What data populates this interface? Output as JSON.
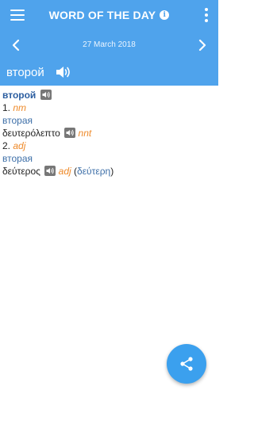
{
  "appbar": {
    "title": "WORD OF THE DAY",
    "menu_icon": "hamburger-menu-icon",
    "info_icon": "info-icon",
    "overflow_icon": "more-vertical-icon"
  },
  "date_nav": {
    "date": "27 March 2018",
    "prev_icon": "chevron-left-icon",
    "next_icon": "chevron-right-icon"
  },
  "word": {
    "headword": "второй",
    "speaker_icon": "speaker-icon"
  },
  "entry": {
    "headword": "второй",
    "sense1_number": "1.",
    "sense1_pos": "nm",
    "sense1_translation": "вторая",
    "compound_word": "δευτερόλεπτο",
    "compound_pos": "nnt",
    "sense2_number": "2.",
    "sense2_pos": "adj",
    "sense2_translation": "вторая",
    "derived_word": "δεύτερος",
    "derived_pos": "adj",
    "derived_paren_open": "(",
    "derived_form": "δεύτερη",
    "derived_paren_close": ")"
  },
  "fab": {
    "icon": "share-icon"
  },
  "colors": {
    "primary": "#4fa3ec",
    "fab": "#3ba0ee",
    "pos": "#ee8a2a",
    "link": "#3d6fa8",
    "heading": "#2c5ea0"
  }
}
